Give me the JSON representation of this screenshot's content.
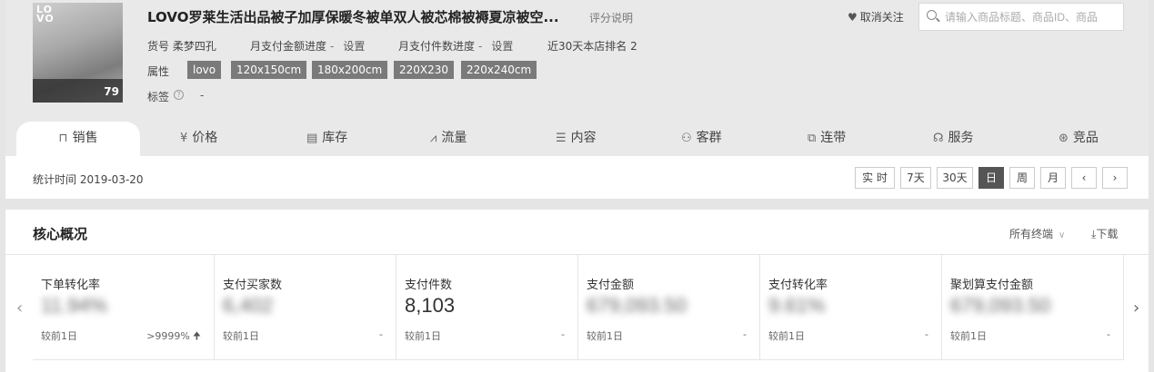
{
  "product": {
    "title": "LOVO罗莱生活出品被子加厚保暖冬被单双人被芯棉被褥夏凉被空...",
    "rating_hint": "评分说明",
    "thumb": {
      "logo_line1": "LO",
      "logo_line2": "VO",
      "price_badge": "79"
    },
    "item_no_label": "货号",
    "item_no": "柔梦四孔",
    "pay_amount_progress_label": "月支付金额进度",
    "pay_amount_progress_value": "-",
    "pay_amount_progress_link": "设置",
    "pay_count_progress_label": "月支付件数进度",
    "pay_count_progress_value": "-",
    "pay_count_progress_link": "设置",
    "rank_text": "近30天本店排名 2",
    "attr_label": "属性",
    "attrs": [
      "lovo",
      "120x150cm",
      "180x200cm",
      "220X230",
      "220x240cm"
    ],
    "tags_label": "标签",
    "tags_value": "-"
  },
  "header": {
    "unfollow_label": "取消关注",
    "search_placeholder": "请输入商品标题、商品ID、商品"
  },
  "tabs": [
    {
      "label": "销售",
      "icon": "bag-icon",
      "glyph": "⊓"
    },
    {
      "label": "价格",
      "icon": "yen-icon",
      "glyph": "¥"
    },
    {
      "label": "库存",
      "icon": "inventory-icon",
      "glyph": "▤"
    },
    {
      "label": "流量",
      "icon": "trend-icon",
      "glyph": "⩘"
    },
    {
      "label": "内容",
      "icon": "content-icon",
      "glyph": "☰"
    },
    {
      "label": "客群",
      "icon": "users-icon",
      "glyph": "⚇"
    },
    {
      "label": "连带",
      "icon": "link-icon",
      "glyph": "⧉"
    },
    {
      "label": "服务",
      "icon": "headset-icon",
      "glyph": "☊"
    },
    {
      "label": "竞品",
      "icon": "compete-icon",
      "glyph": "⊛"
    }
  ],
  "timebar": {
    "stat_time": "统计时间 2019-03-20",
    "buttons": [
      "实 时",
      "7天",
      "30天",
      "日",
      "周",
      "月"
    ],
    "active": "日",
    "prev": "‹",
    "next": "›"
  },
  "core": {
    "title": "核心概况",
    "all_terminals": "所有终端",
    "download": "下载",
    "metrics": [
      {
        "label": "下单转化率",
        "value": "11.94%",
        "blurred": true,
        "compare_label": "较前1日",
        "change": ">9999%",
        "change_dir": "up"
      },
      {
        "label": "支付买家数",
        "value": "6,402",
        "blurred": true,
        "compare_label": "较前1日",
        "change": "-"
      },
      {
        "label": "支付件数",
        "value": "8,103",
        "blurred": false,
        "compare_label": "较前1日",
        "change": "-"
      },
      {
        "label": "支付金额",
        "value": "679,093.50",
        "blurred": true,
        "compare_label": "较前1日",
        "change": "-"
      },
      {
        "label": "支付转化率",
        "value": "9.61%",
        "blurred": true,
        "compare_label": "较前1日",
        "change": "-"
      },
      {
        "label": "聚划算支付金额",
        "value": "679,093.50",
        "blurred": true,
        "compare_label": "较前1日",
        "change": "-"
      }
    ]
  }
}
